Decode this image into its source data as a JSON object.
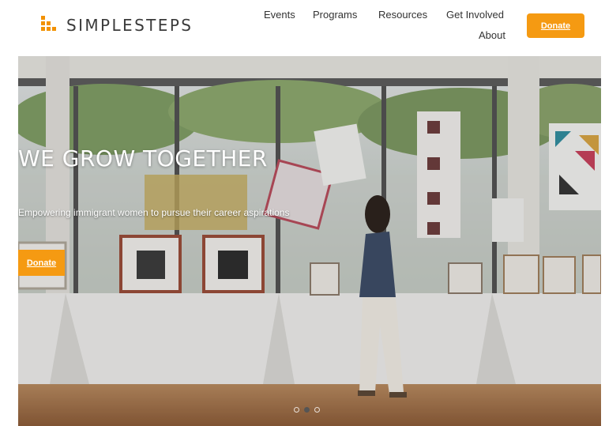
{
  "brand": {
    "name": "SIMPLESTEPS",
    "accent": "#f59a12",
    "logo_icon": "stepped-squares-logo-icon"
  },
  "nav": {
    "items": [
      {
        "id": "events",
        "label": "Events"
      },
      {
        "id": "programs",
        "label": "Programs"
      },
      {
        "id": "resources",
        "label": "Resources"
      },
      {
        "id": "get-involved",
        "label": "Get Involved"
      },
      {
        "id": "about",
        "label": "About"
      }
    ],
    "donate_label": "Donate"
  },
  "hero": {
    "title": "WE GROW TOGETHER",
    "subtitle": "Empowering immigrant women to pursue their career aspirations",
    "cta_label": "Donate",
    "slides": 3,
    "active_slide": 2
  }
}
